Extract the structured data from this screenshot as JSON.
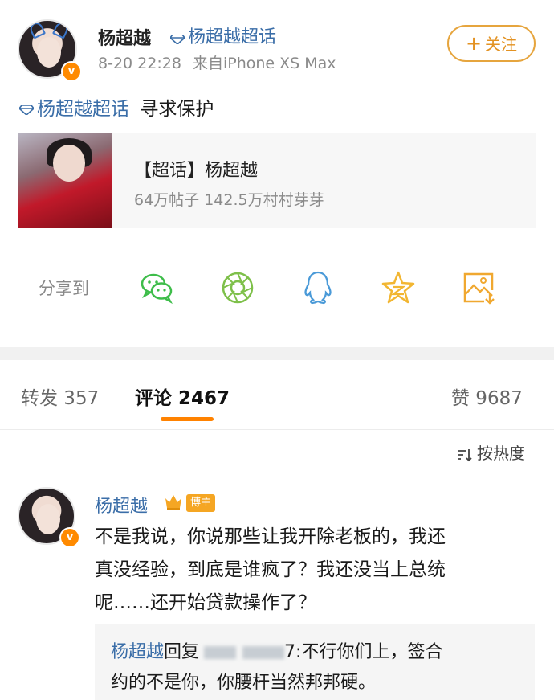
{
  "post": {
    "author": "杨超越",
    "supertopic_link": "杨超越超话",
    "time": "8-20 22:28",
    "source": "来自iPhone XS Max",
    "follow_label": "关注",
    "follow_plus": "+",
    "body_topic": "杨超越超话",
    "body_text": "寻求保护",
    "verified_badge": "v"
  },
  "card": {
    "title": "【超话】杨超越",
    "subtitle": "64万帖子 142.5万村村芽芽"
  },
  "share": {
    "label": "分享到",
    "icons": [
      "wechat-icon",
      "moments-icon",
      "qq-icon",
      "qzone-icon",
      "save-image-icon"
    ]
  },
  "tabs": [
    {
      "label": "转发 357"
    },
    {
      "label": "评论 2467"
    },
    {
      "label": "赞 9687"
    }
  ],
  "sort": {
    "label": "按热度"
  },
  "comment": {
    "author": "杨超越",
    "tag": "博主",
    "lines": [
      "不是我说，你说那些让我开除老板的，我还",
      "真没经验，到底是谁疯了？我还没当上总统",
      "呢……还开始贷款操作了？"
    ],
    "reply": {
      "name": "杨超越",
      "prefix": "回复",
      "line1_tail": "7:不行你们上，签合",
      "line2": "约的不是你，你腰杆当然邦邦硬。"
    }
  },
  "colors": {
    "accent_orange": "#ff8200",
    "link_blue": "#3b6ea8",
    "follow_border": "#e6a53e"
  }
}
